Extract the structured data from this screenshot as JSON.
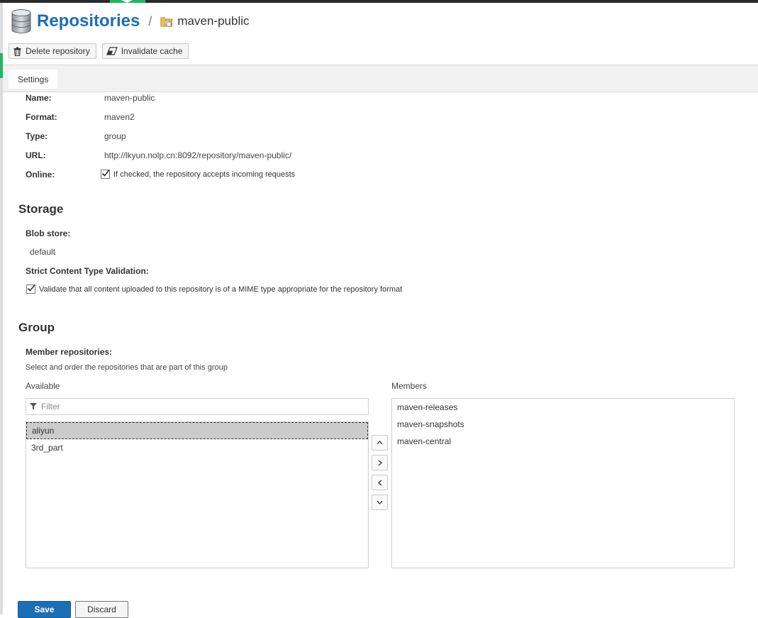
{
  "header": {
    "title": "Repositories",
    "separator": "/",
    "repository_name": "maven-public",
    "title_icon": "database-icon",
    "breadcrumb_icon": "repository-group-icon"
  },
  "toolbar": {
    "delete_label": "Delete repository",
    "delete_icon": "trash-icon",
    "invalidate_label": "Invalidate cache",
    "invalidate_icon": "eraser-icon"
  },
  "tabs": [
    {
      "label": "Settings",
      "active": true
    }
  ],
  "settings": {
    "name_label": "Name:",
    "name_value": "maven-public",
    "format_label": "Format:",
    "format_value": "maven2",
    "type_label": "Type:",
    "type_value": "group",
    "url_label": "URL:",
    "url_value": "http://lkyun.nolp.cn:8092/repository/maven-public/",
    "online_label": "Online:",
    "online_checked": true,
    "online_text": "If checked, the repository accepts incoming requests"
  },
  "storage": {
    "heading": "Storage",
    "blob_store_label": "Blob store:",
    "blob_store_value": "default",
    "strict_label": "Strict Content Type Validation:",
    "strict_checked": true,
    "strict_text": "Validate that all content uploaded to this repository is of a MIME type appropriate for the repository format"
  },
  "group": {
    "heading": "Group",
    "members_label": "Member repositories:",
    "members_help": "Select and order the repositories that are part of this group",
    "available_label": "Available",
    "members_list_label": "Members",
    "filter_placeholder": "Filter",
    "available": [
      "aliyun",
      "3rd_part"
    ],
    "available_selected": "aliyun",
    "members": [
      "maven-releases",
      "maven-snapshots",
      "maven-central"
    ]
  },
  "actions": {
    "save_label": "Save",
    "discard_label": "Discard"
  },
  "colors": {
    "accent": "#1b6fb5",
    "green": "#1fb860",
    "selected_row": "#cbcbcb"
  }
}
